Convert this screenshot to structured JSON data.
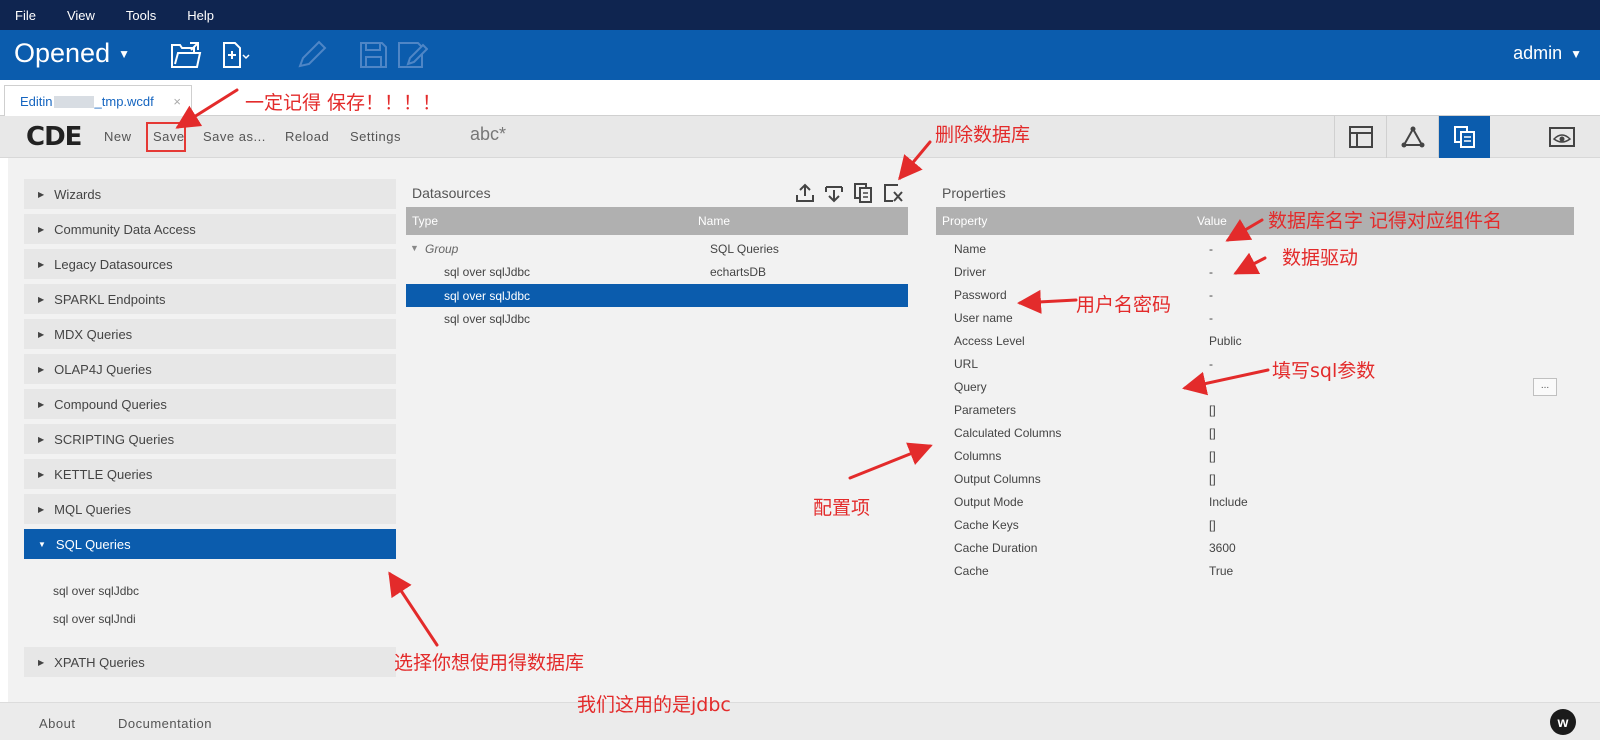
{
  "menu": [
    "File",
    "View",
    "Tools",
    "Help"
  ],
  "header": {
    "perspective": "Opened",
    "user": "admin"
  },
  "tab": {
    "name_prefix": "Editin",
    "name_suffix": "_tmp.wcdf",
    "close": "×"
  },
  "toolbar": {
    "logo": "CDE",
    "new": "New",
    "save": "Save",
    "save_as": "Save as...",
    "reload": "Reload",
    "settings": "Settings",
    "dashboard_name": "abc*"
  },
  "left_panel": {
    "groups": [
      "Wizards",
      "Community Data Access",
      "Legacy Datasources",
      "SPARKL Endpoints",
      "MDX Queries",
      "OLAP4J Queries",
      "Compound Queries",
      "SCRIPTING Queries",
      "KETTLE Queries",
      "MQL Queries"
    ],
    "active_group": "SQL Queries",
    "sub_items": [
      "sql over sqlJdbc",
      "sql over sqlJndi"
    ],
    "last_group": "XPATH Queries"
  },
  "datasources": {
    "title": "Datasources",
    "columns": [
      "Type",
      "Name"
    ],
    "group_label": "Group",
    "group_name": "SQL Queries",
    "rows": [
      {
        "type": "sql over sqlJdbc",
        "name": "echartsDB"
      },
      {
        "type": "sql over sqlJdbc",
        "name": ""
      },
      {
        "type": "sql over sqlJdbc",
        "name": ""
      }
    ]
  },
  "properties": {
    "title": "Properties",
    "columns": [
      "Property",
      "Value"
    ],
    "rows": [
      {
        "key": "Name",
        "value": "-"
      },
      {
        "key": "Driver",
        "value": "-"
      },
      {
        "key": "Password",
        "value": "-"
      },
      {
        "key": "User name",
        "value": "-"
      },
      {
        "key": "Access Level",
        "value": "Public"
      },
      {
        "key": "URL",
        "value": "-"
      },
      {
        "key": "Query",
        "value": ""
      },
      {
        "key": "Parameters",
        "value": "[]"
      },
      {
        "key": "Calculated Columns",
        "value": "[]"
      },
      {
        "key": "Columns",
        "value": "[]"
      },
      {
        "key": "Output Columns",
        "value": "[]"
      },
      {
        "key": "Output Mode",
        "value": "Include"
      },
      {
        "key": "Cache Keys",
        "value": "[]"
      },
      {
        "key": "Cache Duration",
        "value": "3600"
      },
      {
        "key": "Cache",
        "value": "True"
      }
    ],
    "query_button": "..."
  },
  "footer": {
    "about": "About",
    "documentation": "Documentation",
    "logo_letter": "w"
  },
  "annotations": {
    "save_note": "一定记得  保存！！！！",
    "delete_note": "删除数据库",
    "name_note": "数据库名字 记得对应组件名",
    "driver_note": "数据驱动",
    "user_note": "用户名密码",
    "sql_note": "填写sql参数",
    "config_note": "配置项",
    "choose_note": "选择你想使用得数据库",
    "jdbc_note": "我们这用的是jdbc"
  },
  "colors": {
    "menubar": "#0f2550",
    "header": "#0b5cad",
    "accent": "#0b5cad",
    "annotation": "#e32b2b"
  }
}
